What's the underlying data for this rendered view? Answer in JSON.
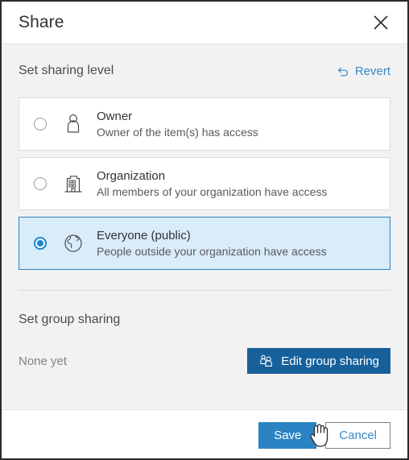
{
  "dialog": {
    "title": "Share",
    "close_icon": "close-icon"
  },
  "sharing_level": {
    "section_title": "Set sharing level",
    "revert_label": "Revert",
    "revert_icon": "undo-arrow-icon",
    "options": [
      {
        "label": "Owner",
        "description": "Owner of the item(s) has access",
        "icon": "person-icon",
        "selected": false
      },
      {
        "label": "Organization",
        "description": "All members of your organization have access",
        "icon": "building-icon",
        "selected": false
      },
      {
        "label": "Everyone (public)",
        "description": "People outside your organization have access",
        "icon": "globe-icon",
        "selected": true
      }
    ]
  },
  "group_sharing": {
    "section_title": "Set group sharing",
    "empty_text": "None yet",
    "edit_button_label": "Edit group sharing",
    "edit_button_icon": "users-group-icon"
  },
  "footer": {
    "save_label": "Save",
    "cancel_label": "Cancel"
  },
  "colors": {
    "accent_blue": "#2b83c4",
    "dark_blue": "#16619c",
    "link_blue": "#3989c8",
    "selected_bg": "#d8ecfa",
    "body_bg": "#f2f2f2"
  }
}
